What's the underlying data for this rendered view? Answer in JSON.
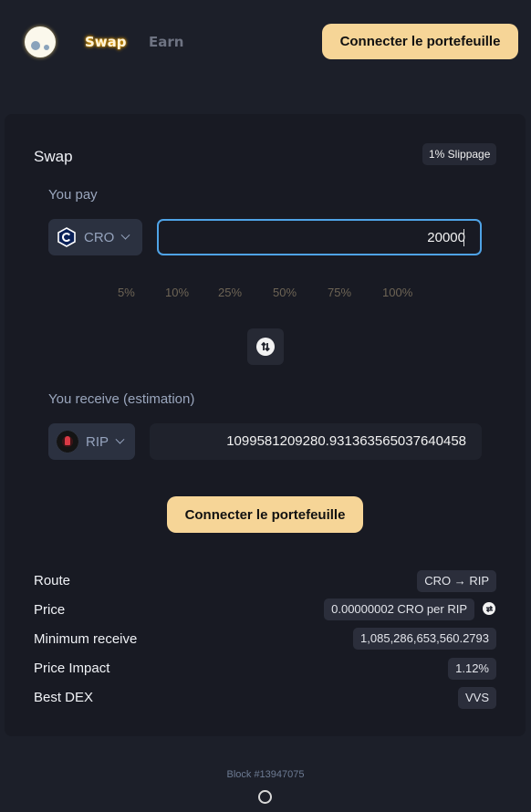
{
  "header": {
    "logo_icon": "ghost-logo-icon",
    "nav": [
      {
        "label": "Swap",
        "active": true
      },
      {
        "label": "Earn",
        "active": false
      }
    ],
    "connect_label": "Connecter le portefeuille"
  },
  "swap": {
    "title": "Swap",
    "slippage": "1% Slippage",
    "pay": {
      "label": "You pay",
      "token": "CRO",
      "token_icon": "cro-icon",
      "amount": "20000"
    },
    "percentages": [
      "5%",
      "10%",
      "25%",
      "50%",
      "75%",
      "100%"
    ],
    "flip_icon": "swap-direction-icon",
    "receive": {
      "label": "You receive (estimation)",
      "token": "RIP",
      "token_icon": "rip-token-icon",
      "amount": "1099581209280.931363565037640458"
    },
    "connect_label": "Connecter le portefeuille",
    "details": [
      {
        "label": "Route",
        "value": "CRO → RIP"
      },
      {
        "label": "Price",
        "value": "0.00000002 CRO per RIP"
      },
      {
        "label": "Minimum receive",
        "value": "1,085,286,653,560.2793"
      },
      {
        "label": "Price Impact",
        "value": "1.12%"
      },
      {
        "label": "Best DEX",
        "value": "VVS"
      }
    ]
  },
  "footer": {
    "block": "Block #13947075"
  },
  "colors": {
    "accent": "#f6d597",
    "input_focus": "#4fa3e6",
    "background": "#1c1f29",
    "card": "#181a23"
  }
}
